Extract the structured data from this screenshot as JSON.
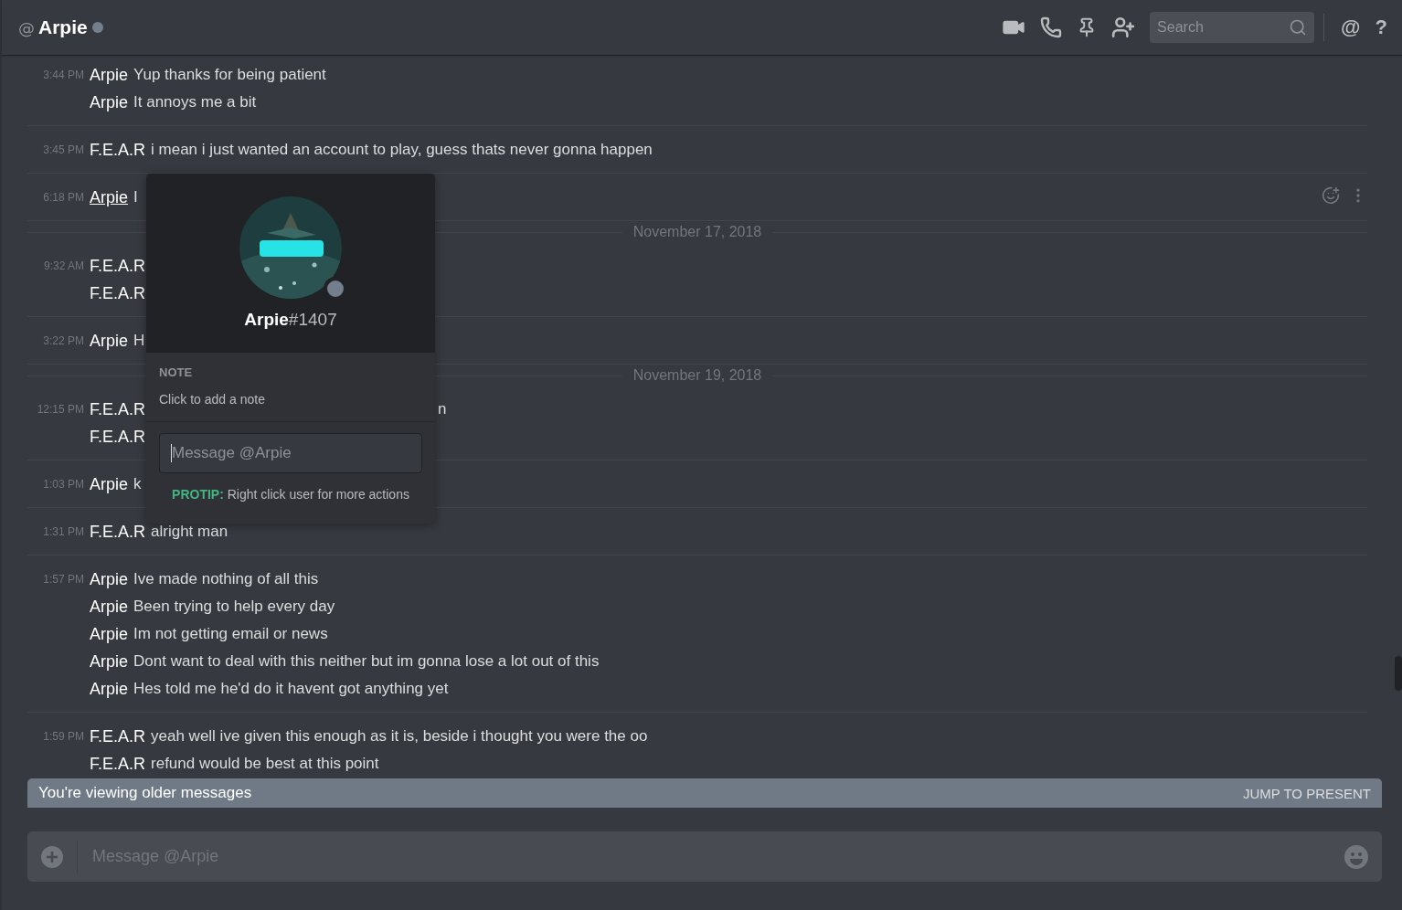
{
  "header": {
    "at": "@",
    "title": "Arpie",
    "online": false,
    "search": {
      "placeholder": "Search"
    },
    "mention": "@",
    "help": "?"
  },
  "messages": [
    {
      "kind": "group",
      "time": "3:44 PM",
      "hovered": false,
      "lines": [
        {
          "author": "Arpie",
          "text": "Yup thanks for being patient"
        },
        {
          "author": "Arpie",
          "text": "It annoys me a bit"
        }
      ]
    },
    {
      "kind": "group",
      "time": "3:45 PM",
      "hovered": false,
      "lines": [
        {
          "author": "F.E.A.R",
          "text": "i mean i just wanted an account to play, guess thats never gonna happen"
        }
      ]
    },
    {
      "kind": "group",
      "time": "6:18 PM",
      "hovered": true,
      "lines": [
        {
          "author": "Arpie",
          "text": "I"
        }
      ]
    },
    {
      "kind": "date",
      "label": "November 17, 2018"
    },
    {
      "kind": "group",
      "time": "9:32 AM",
      "hovered": false,
      "lines": [
        {
          "author": "F.E.A.R"
        },
        {
          "author": "F.E.A.R"
        }
      ]
    },
    {
      "kind": "group",
      "time": "3:22 PM",
      "hovered": false,
      "lines": [
        {
          "author": "Arpie",
          "text": "H"
        }
      ]
    },
    {
      "kind": "date",
      "label": "November 19, 2018"
    },
    {
      "kind": "group",
      "time": "12:15 PM",
      "hovered": false,
      "lines": [
        {
          "author": "F.E.A.R",
          "text": "n",
          "covered": true
        },
        {
          "author": "F.E.A.R"
        }
      ]
    },
    {
      "kind": "group",
      "time": "1:03 PM",
      "hovered": false,
      "lines": [
        {
          "author": "Arpie",
          "text": "k"
        }
      ]
    },
    {
      "kind": "group",
      "time": "1:31 PM",
      "hovered": false,
      "lines": [
        {
          "author": "F.E.A.R",
          "text": "alright man"
        }
      ]
    },
    {
      "kind": "group",
      "time": "1:57 PM",
      "hovered": false,
      "lines": [
        {
          "author": "Arpie",
          "text": "Ive made nothing of all this"
        },
        {
          "author": "Arpie",
          "text": "Been trying to help every day"
        },
        {
          "author": "Arpie",
          "text": "Im not getting email or news"
        },
        {
          "author": "Arpie",
          "text": "Dont want to deal with this neither but im gonna lose a lot out of this"
        },
        {
          "author": "Arpie",
          "text": "Hes told me he'd do it havent got anything yet"
        }
      ]
    },
    {
      "kind": "group",
      "time": "1:59 PM",
      "hovered": false,
      "lines": [
        {
          "author": "F.E.A.R",
          "text": "yeah well ive given this enough as it is, beside i thought you were the oo"
        },
        {
          "author": "F.E.A.R",
          "text": "refund would be best at this point"
        }
      ]
    }
  ],
  "popup": {
    "username": "Arpie",
    "tag": "#1407",
    "online": false,
    "note_label": "NOTE",
    "note_placeholder": "Click to add a note",
    "message_placeholder": "Message @Arpie",
    "focused": true,
    "protip_label": "PROTIP:",
    "protip_text": "Right click user for more actions"
  },
  "older_bar": {
    "text": "You're viewing older messages",
    "action": "JUMP TO PRESENT"
  },
  "composer": {
    "placeholder": "Message @Arpie"
  }
}
